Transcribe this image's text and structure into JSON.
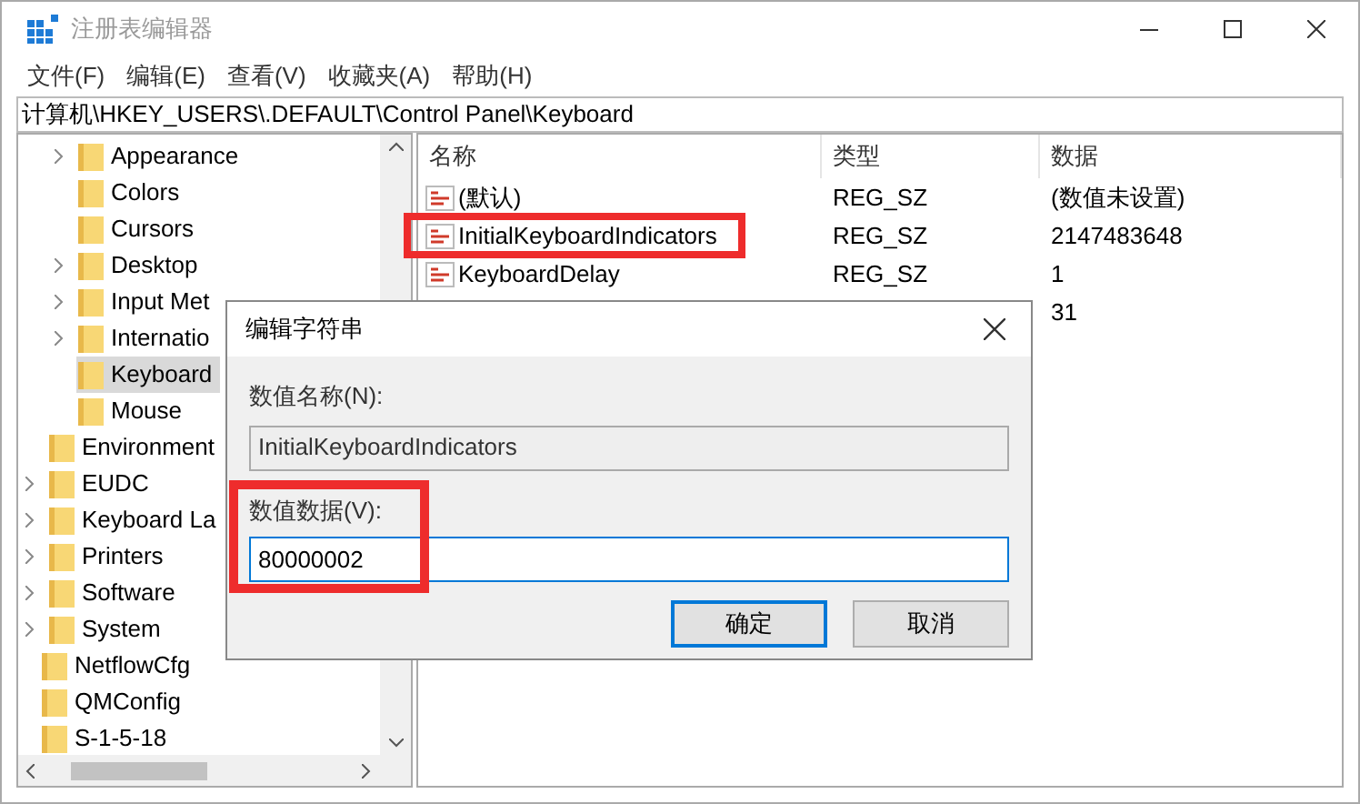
{
  "window": {
    "title": "注册表编辑器"
  },
  "menu": [
    "文件(F)",
    "编辑(E)",
    "查看(V)",
    "收藏夹(A)",
    "帮助(H)"
  ],
  "address": "计算机\\HKEY_USERS\\.DEFAULT\\Control Panel\\Keyboard",
  "tree": [
    {
      "children": [
        {
          "children": [
            {
              "label": "Appearance",
              "expandable": true,
              "selected": false
            },
            {
              "label": "Colors",
              "expandable": false,
              "selected": false
            },
            {
              "label": "Cursors",
              "expandable": false,
              "selected": false
            },
            {
              "label": "Desktop",
              "expandable": true,
              "selected": false
            },
            {
              "label": "Input Met",
              "expandable": true,
              "selected": false
            },
            {
              "label": "Internatio",
              "expandable": true,
              "selected": false
            },
            {
              "label": "Keyboard",
              "expandable": false,
              "selected": true
            },
            {
              "label": "Mouse",
              "expandable": false,
              "selected": false
            }
          ]
        },
        {
          "label": "Environment",
          "expandable": false,
          "selected": false
        },
        {
          "label": "EUDC",
          "expandable": true,
          "selected": false
        },
        {
          "label": "Keyboard La",
          "expandable": true,
          "selected": false
        },
        {
          "label": "Printers",
          "expandable": true,
          "selected": false
        },
        {
          "label": "Software",
          "expandable": true,
          "selected": false
        },
        {
          "label": "System",
          "expandable": true,
          "selected": false
        }
      ]
    },
    {
      "label": "NetflowCfg",
      "expandable": false,
      "selected": false
    },
    {
      "label": "QMConfig",
      "expandable": false,
      "selected": false
    },
    {
      "label": "S-1-5-18",
      "expandable": false,
      "selected": false
    }
  ],
  "table": {
    "columns": [
      "名称",
      "类型",
      "数据"
    ],
    "rows": [
      {
        "name": "(默认)",
        "type": "REG_SZ",
        "data": "(数值未设置)",
        "highlighted": false
      },
      {
        "name": "InitialKeyboardIndicators",
        "type": "REG_SZ",
        "data": "2147483648",
        "highlighted": true
      },
      {
        "name": "KeyboardDelay",
        "type": "REG_SZ",
        "data": "1",
        "highlighted": false
      },
      {
        "data": "31",
        "highlighted": false
      }
    ]
  },
  "dialog": {
    "title": "编辑字符串",
    "name_label": "数值名称(N):",
    "name_value": "InitialKeyboardIndicators",
    "data_label": "数值数据(V):",
    "data_value": "80000002",
    "data_highlighted": true,
    "buttons": [
      "确定",
      "取消"
    ]
  }
}
